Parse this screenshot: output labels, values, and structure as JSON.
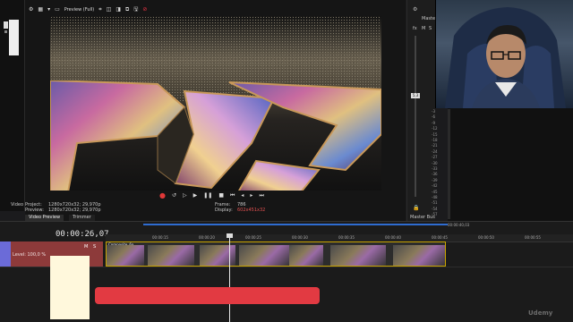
{
  "preview": {
    "mode_label": "Preview (Full)",
    "project_label": "Project:",
    "project_value": "1280x720x32; 29,970p",
    "preview_label": "Preview:",
    "preview_value": "1280x720x32; 29,970p",
    "frame_label": "Frame:",
    "frame_value": "786",
    "display_label": "Display:",
    "display_value": "602x451x32",
    "video_label": "Video",
    "tabs": [
      "Video Preview",
      "Trimmer"
    ]
  },
  "master": {
    "title": "Master",
    "fx_label": "fx",
    "m_label": "M",
    "s_label": "S",
    "bus_label": "Master Bus",
    "level_readout": "5.3",
    "scale": [
      "-3",
      "-6",
      "-9",
      "-12",
      "-15",
      "-18",
      "-21",
      "-24",
      "-27",
      "-30",
      "-33",
      "-36",
      "-39",
      "-42",
      "-45",
      "-48",
      "-51",
      "-54",
      "-57"
    ]
  },
  "timeline": {
    "timecode": "00:00:26,07",
    "track_level": "Level: 100,0 %",
    "m_label": "M",
    "s_label": "S",
    "ruler_marks": [
      "00:00:15",
      "00:00:20",
      "00:00:25",
      "00:00:30",
      "00:00:35",
      "00:00:40",
      "00:00:45",
      "00:00:50",
      "00:00:55"
    ],
    "clip_label": "Composite_6a",
    "end_marker": "00:00:40,03"
  },
  "watermark": "Udemy",
  "colors": {
    "accent_red": "#e23a42",
    "track_blue": "#6b6bd8",
    "clip_border": "#c9a400"
  }
}
